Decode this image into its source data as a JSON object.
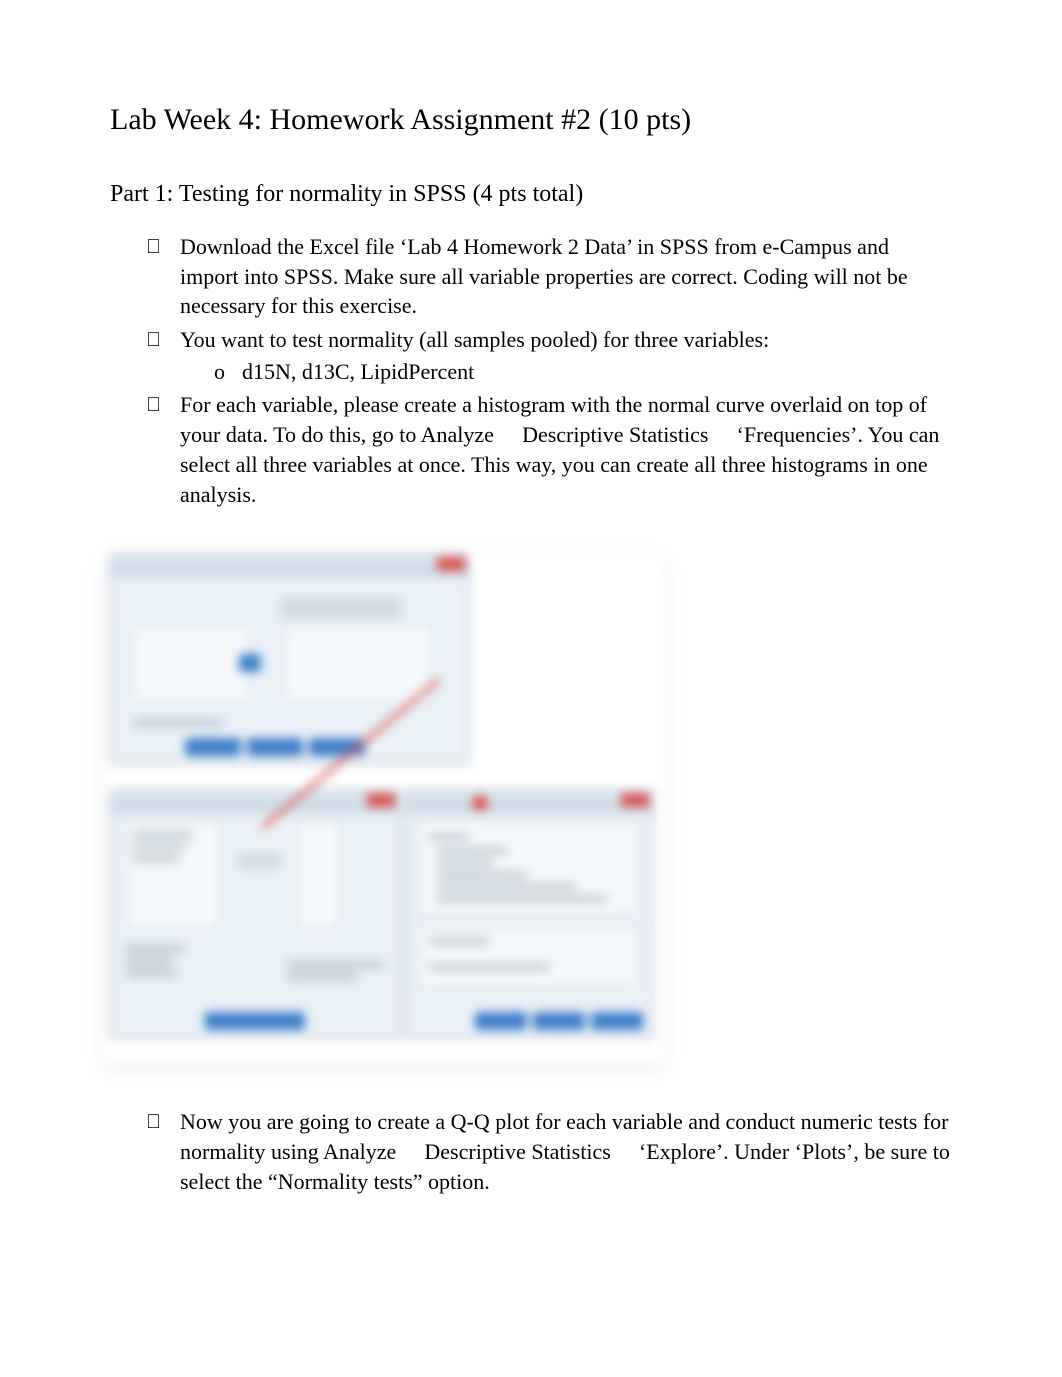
{
  "title": "Lab Week 4: Homework Assignment #2 (10 pts)",
  "part1": {
    "heading": "Part 1: Testing for normality in SPSS (4 pts total)",
    "bullets": [
      {
        "text": "Download the Excel file ‘Lab 4 Homework 2 Data’ in SPSS from e-Campus and import into SPSS. Make sure all variable properties are correct. Coding will not be necessary for this exercise."
      },
      {
        "text": "You want to test normality (all samples pooled) for three variables:",
        "sub": [
          "d15N, d13C, LipidPercent"
        ]
      },
      {
        "text": "For each variable, please create a histogram with the normal curve overlaid on top of your data. To do this, go to Analyze  Descriptive Statistics  ‘Frequencies’. You can select all three variables at once. This way, you can create all three histograms in one analysis."
      }
    ],
    "bullets2": [
      {
        "text": "Now you are going to create a Q-Q plot for each variable and conduct numeric tests for normality using Analyze  Descriptive Statistics  ‘Explore’. Under ‘Plots’, be sure to select the “Normality tests” option."
      }
    ],
    "sublabel_o": "o"
  },
  "icons": {
    "bullet_glyph": ""
  }
}
